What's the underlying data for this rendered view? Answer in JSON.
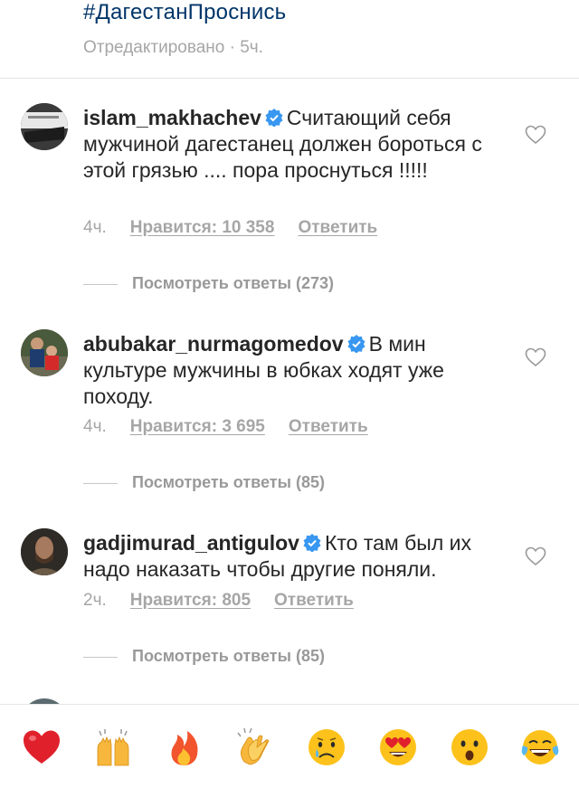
{
  "post": {
    "hashtag": "#ДагестанПроснись",
    "meta": "Отредактировано · 5ч."
  },
  "comments": [
    {
      "username": "islam_makhachev",
      "text": "Считающий себя мужчиной дагестанец должен бороться с этой грязью .... пора проснуться !!!!!",
      "time": "4ч.",
      "likes": "Нравится: 10 358",
      "reply": "Ответить",
      "view_replies": "Посмотреть ответы (273)"
    },
    {
      "username": "abubakar_nurmagomedov",
      "text": "В мин культуре мужчины в юбках ходят уже походу.",
      "time": "4ч.",
      "likes": "Нравится: 3 695",
      "reply": "Ответить",
      "view_replies": "Посмотреть ответы (85)"
    },
    {
      "username": "gadjimurad_antigulov",
      "text": "Кто там был их надо наказать чтобы другие поняли.",
      "time": "2ч.",
      "likes": "Нравится: 805",
      "reply": "Ответить",
      "view_replies": "Посмотреть ответы (85)"
    }
  ],
  "emoji_bar": [
    "red-heart",
    "raising-hands",
    "fire",
    "clapping-hands",
    "crying-face",
    "heart-eyes",
    "surprised-face",
    "tears-of-joy"
  ],
  "colors": {
    "hashtag": "#003569",
    "muted": "#a6a6a6",
    "verified": "#3897f0",
    "text": "#262626"
  }
}
